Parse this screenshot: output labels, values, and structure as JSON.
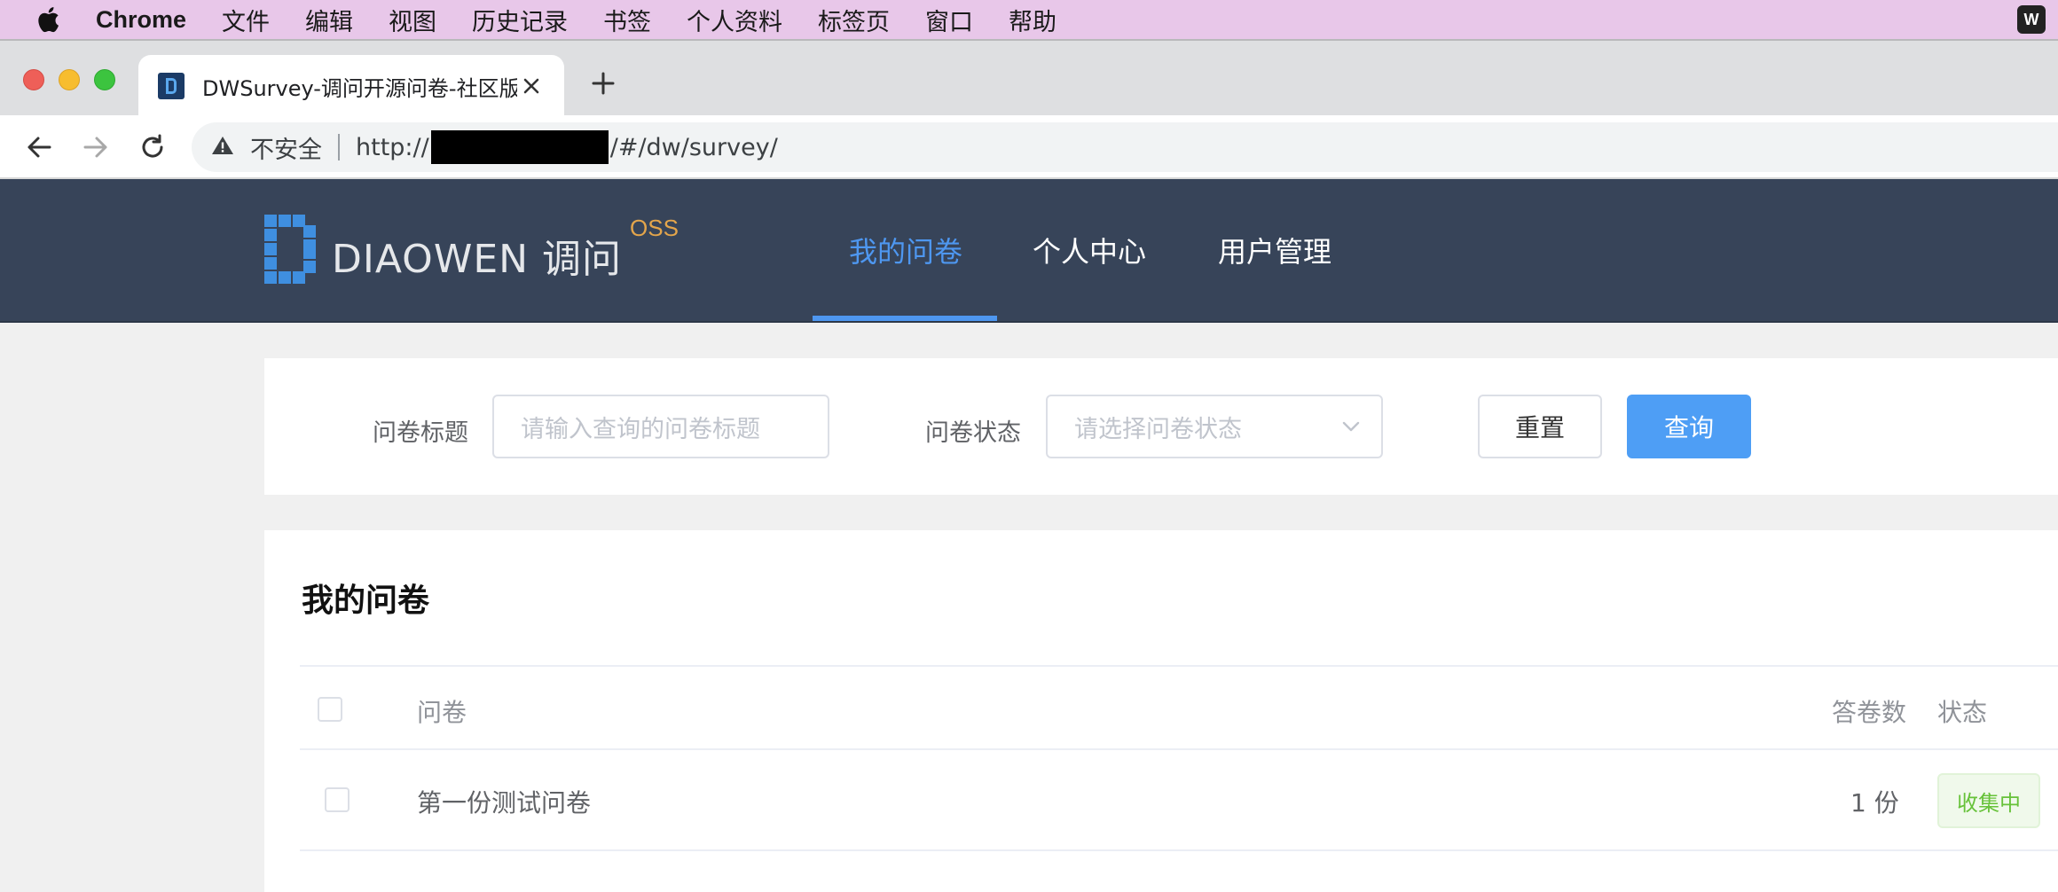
{
  "menubar": {
    "app": "Chrome",
    "items": [
      "文件",
      "编辑",
      "视图",
      "历史记录",
      "书签",
      "个人资料",
      "标签页",
      "窗口",
      "帮助"
    ],
    "wps_label": "W"
  },
  "tab": {
    "title": "DWSurvey-调问开源问卷-社区版"
  },
  "address": {
    "security_label": "不安全",
    "url_prefix": "http://",
    "url_suffix": "/#/dw/survey/"
  },
  "header": {
    "logo_text": "DIAOWEN 调问",
    "logo_badge": "OSS",
    "nav": [
      {
        "label": "我的问卷",
        "active": true
      },
      {
        "label": "个人中心",
        "active": false
      },
      {
        "label": "用户管理",
        "active": false
      }
    ]
  },
  "filter": {
    "title_label": "问卷标题",
    "title_placeholder": "请输入查询的问卷标题",
    "status_label": "问卷状态",
    "status_placeholder": "请选择问卷状态",
    "reset_label": "重置",
    "query_label": "查询"
  },
  "list": {
    "title": "我的问卷",
    "columns": {
      "survey": "问卷",
      "answers": "答卷数",
      "status": "状态"
    },
    "rows": [
      {
        "name": "第一份测试问卷",
        "answers": "1 份",
        "status": "收集中"
      }
    ]
  },
  "colors": {
    "header_bg": "#374459",
    "accent": "#4e97f0",
    "status_green": "#67c23a",
    "menubar_bg": "#e8c7e9"
  }
}
